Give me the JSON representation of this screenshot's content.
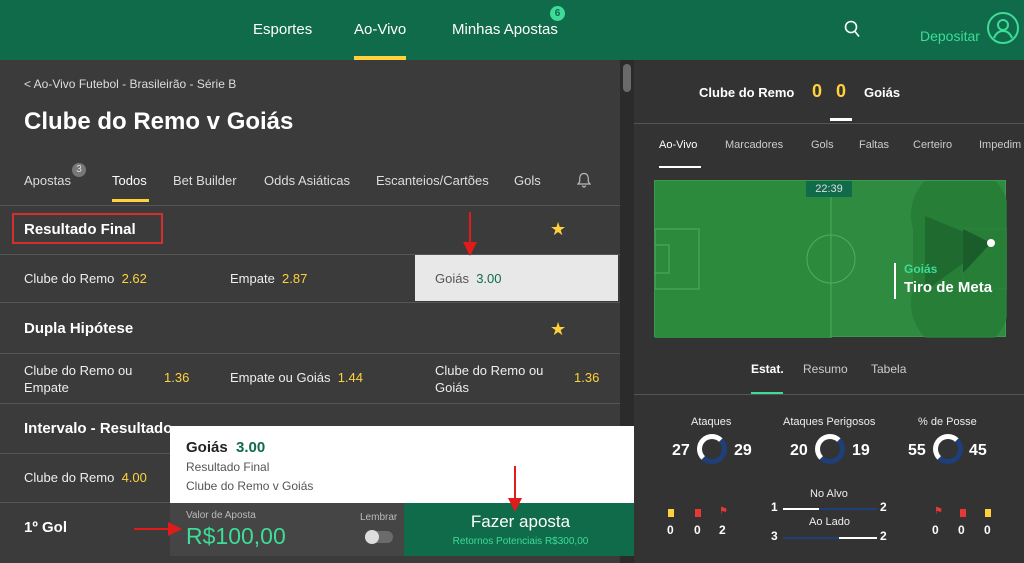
{
  "nav": {
    "sports": "Esportes",
    "live": "Ao-Vivo",
    "my_bets": "Minhas Apostas",
    "my_bets_count": "6",
    "deposit": "Depositar"
  },
  "breadcrumb": "< Ao-Vivo Futebol - Brasileirão - Série B",
  "match_title": "Clube do Remo v Goiás",
  "tabs": [
    {
      "label": "Apostas",
      "badge": "3"
    },
    {
      "label": "Todos"
    },
    {
      "label": "Bet Builder"
    },
    {
      "label": "Odds Asiáticas"
    },
    {
      "label": "Escanteios/Cartões"
    },
    {
      "label": "Gols"
    }
  ],
  "markets": {
    "final": {
      "title": "Resultado Final",
      "home": "Clube do Remo",
      "home_odd": "2.62",
      "draw": "Empate",
      "draw_odd": "2.87",
      "away": "Goiás",
      "away_odd": "3.00"
    },
    "double": {
      "title": "Dupla Hipótese",
      "opt1_l1": "Clube do Remo ou",
      "opt1_l2": "Empate",
      "opt1_odd": "1.36",
      "opt2": "Empate ou Goiás",
      "opt2_odd": "1.44",
      "opt3_l1": "Clube do Remo ou",
      "opt3_l2": "Goiás",
      "opt3_odd": "1.36"
    },
    "half": {
      "title": "Intervalo - Resultado",
      "home": "Clube do Remo",
      "home_odd": "4.00"
    },
    "first_goal": {
      "title": "1º Gol"
    }
  },
  "betslip": {
    "selection": "Goiás",
    "odd": "3.00",
    "market": "Resultado Final",
    "event": "Clube do Remo v Goiás",
    "stake_label": "Valor de Aposta",
    "stake": "R$100,00",
    "remember": "Lembrar",
    "place": "Fazer aposta",
    "returns": "Retornos Potenciais R$300,00"
  },
  "score": {
    "home": "Clube do Remo",
    "home_goals": "0",
    "away_goals": "0",
    "away": "Goiás"
  },
  "right_tabs": [
    "Ao-Vivo",
    "Marcadores",
    "Gols",
    "Faltas",
    "Certeiro",
    "Impedim"
  ],
  "pitch": {
    "clock": "22:39",
    "team": "Goiás",
    "event": "Tiro de Meta"
  },
  "stat_tabs": [
    "Estat.",
    "Resumo",
    "Tabela"
  ],
  "stats": {
    "attacks": {
      "label": "Ataques",
      "home": "27",
      "away": "29"
    },
    "dangerous": {
      "label": "Ataques Perigosos",
      "home": "20",
      "away": "19"
    },
    "possession": {
      "label": "% de Posse",
      "home": "55",
      "away": "45"
    },
    "on_target": {
      "label": "No Alvo",
      "home": "1",
      "away": "2"
    },
    "off_target": {
      "label": "Ao Lado",
      "home": "3",
      "away": "2"
    },
    "home_cards": [
      "0",
      "0",
      "2"
    ],
    "away_cards": [
      "0",
      "0",
      "0"
    ]
  },
  "colors": {
    "brand": "#0f6b4a",
    "accent": "#ffd23c",
    "mint": "#3ddc97",
    "annotation": "#d32f2f"
  }
}
